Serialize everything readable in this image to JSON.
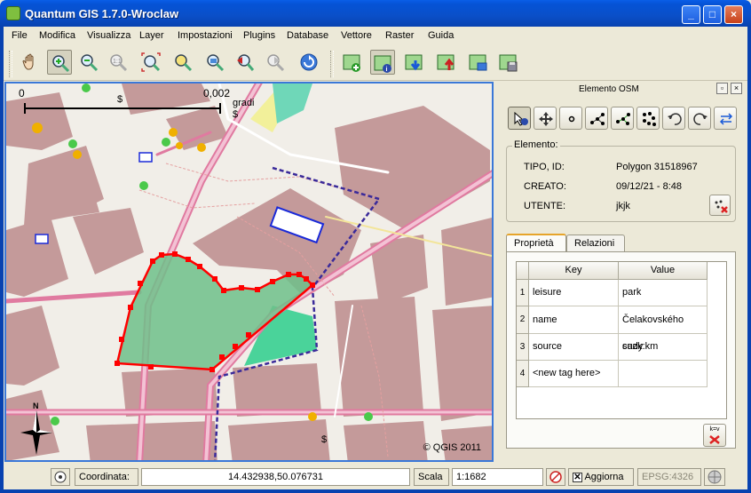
{
  "window": {
    "title": "Quantum GIS 1.7.0-Wroclaw",
    "min": "_",
    "max": "□",
    "close": "×"
  },
  "menu": [
    "File",
    "Modifica",
    "Visualizza",
    "Layer",
    "Impostazioni",
    "Plugins",
    "Database",
    "Vettore",
    "Raster",
    "Guida"
  ],
  "toolbar": {
    "nav_icons": [
      "pan-icon",
      "zoom-in-icon",
      "zoom-out-icon",
      "zoom-actual-icon",
      "zoom-full-icon",
      "zoom-selection-icon",
      "zoom-layer-icon",
      "zoom-last-icon",
      "zoom-next-icon",
      "refresh-icon"
    ],
    "osm_icons": [
      "osm-load-icon",
      "osm-info-icon",
      "osm-download-icon",
      "osm-upload-icon",
      "osm-import-icon",
      "osm-save-icon"
    ]
  },
  "map": {
    "scale_zero": "0",
    "scale_value": "0,002",
    "scale_unit": "gradi",
    "copyright": "© QGIS 2011",
    "north_label": "N"
  },
  "osm_panel": {
    "title": "Elemento OSM",
    "element_group": "Elemento:",
    "tipo_label": "TIPO, ID:",
    "tipo_value": "Polygon  31518967",
    "creato_label": "CREATO:",
    "creato_value": "09/12/21 - 8:48",
    "utente_label": "UTENTE:",
    "utente_value": "jkjk",
    "tabs": [
      "Proprietà",
      "Relazioni"
    ],
    "columns": [
      "Key",
      "Value"
    ],
    "rows": [
      {
        "n": "1",
        "key": "leisure",
        "value": "park"
      },
      {
        "n": "2",
        "key": "name",
        "value": "Čelakovského sady"
      },
      {
        "n": "3",
        "key": "source",
        "value": "cuzk:km"
      },
      {
        "n": "4",
        "key": "<new tag here>",
        "value": ""
      }
    ],
    "ksv_label": "k=v"
  },
  "status": {
    "coord_label": "Coordinata:",
    "coord_value": "14.432938,50.076731",
    "scale_label": "Scala",
    "scale_value": "1:1682",
    "render_label": "Aggiorna",
    "render_checked": true,
    "crs": "EPSG:4326"
  },
  "colors": {
    "building": "#c49a9a",
    "park": "#6fbf8a",
    "road": "#e07aa0",
    "selection": "#ff0000",
    "boundary": "#3a2a9a"
  }
}
